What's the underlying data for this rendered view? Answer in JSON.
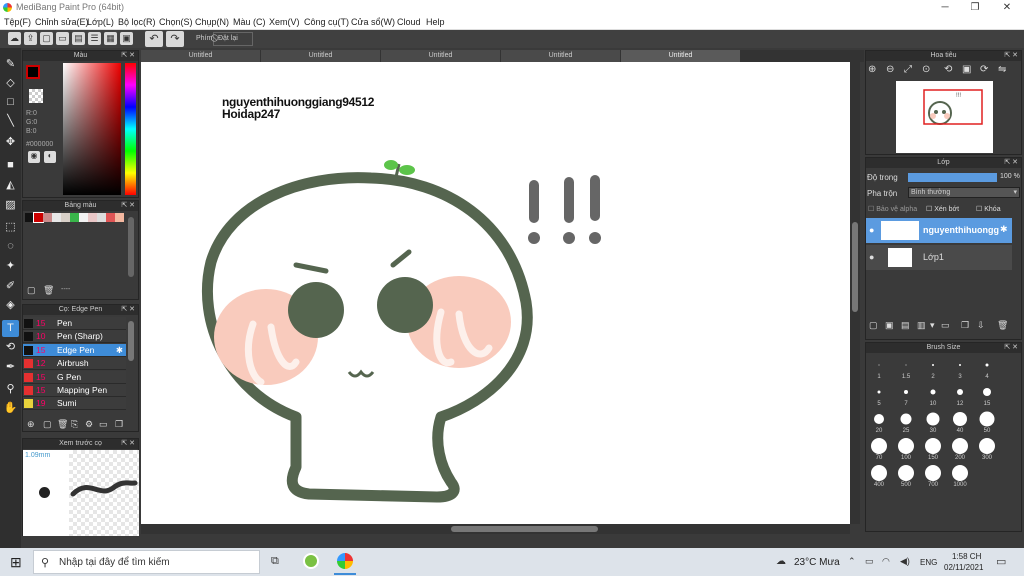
{
  "window": {
    "title": "MediBang Paint Pro (64bit)",
    "min": "─",
    "max": "❐",
    "close": "✕"
  },
  "menu": [
    "Tệp(F)",
    "Chỉnh sửa(E)",
    "Lớp(L)",
    "Bộ lọc(R)",
    "Chọn(S)",
    "Chụp(N)",
    "Màu (C)",
    "Xem(V)",
    "Công cụ(T)",
    "Cửa sổ(W)",
    "Cloud",
    "Help"
  ],
  "toolbar": {
    "phim": "Phím",
    "dat_lai": "Đặt lại"
  },
  "tabs": [
    "Untitled",
    "Untitled",
    "Untitled",
    "Untitled",
    "Untitled"
  ],
  "color_panel": {
    "title": "Màu",
    "r": "R:0",
    "g": "G:0",
    "b": "B:0",
    "hex": "#000000"
  },
  "palette_panel": {
    "title": "Bảng màu",
    "page_label": "----"
  },
  "brush_panel": {
    "title": "Cọ: Edge Pen",
    "items": [
      {
        "size": "15",
        "label": "Pen",
        "color": "#111111"
      },
      {
        "size": "10",
        "label": "Pen (Sharp)",
        "color": "#111111"
      },
      {
        "size": "15",
        "label": "Edge Pen",
        "color": "#111111"
      },
      {
        "size": "12",
        "label": "Airbrush",
        "color": "#e53030"
      },
      {
        "size": "15",
        "label": "G Pen",
        "color": "#e53030"
      },
      {
        "size": "15",
        "label": "Mapping Pen",
        "color": "#e53030"
      },
      {
        "size": "19",
        "label": "Sumi",
        "color": "#e8d23c"
      }
    ]
  },
  "preview_panel": {
    "title": "Xem trước cọ",
    "size_label": "1.09mm"
  },
  "navigator": {
    "title": "Hoa tiêu"
  },
  "layer_panel": {
    "title": "Lớp",
    "opacity_label": "Độ trong",
    "opacity_value": "100 %",
    "opacity": 1.0,
    "blend_label": "Pha trộn",
    "blend_value": "Bình thường",
    "protect_alpha": "Bảo vệ alpha",
    "clipping": "Xén bớt",
    "lock": "Khóa",
    "layers": [
      {
        "name": "nguyenthihuongg"
      },
      {
        "name": "Lớp1"
      }
    ]
  },
  "brush_size_panel": {
    "title": "Brush Size",
    "sizes": [
      "1",
      "1.5",
      "2",
      "3",
      "4",
      "5",
      "7",
      "10",
      "12",
      "15",
      "20",
      "25",
      "30",
      "40",
      "50",
      "70",
      "100",
      "150",
      "200",
      "300",
      "400",
      "500",
      "700",
      "1000"
    ]
  },
  "canvas": {
    "text_line1": "nguyenthihuonggiang94512",
    "text_line2": "Hoidap247",
    "exclaim": "!!!"
  },
  "taskbar": {
    "search_placeholder": "Nhập tại đây để tìm kiếm",
    "weather": "23°C  Mưa",
    "lang": "ENG",
    "time": "1:58 CH",
    "date": "02/11/2021"
  },
  "colors": {
    "accent": "#3e8cd8",
    "panel": "#3a3a3a",
    "stroke": "#55654f",
    "blush": "#f9cbbd"
  }
}
